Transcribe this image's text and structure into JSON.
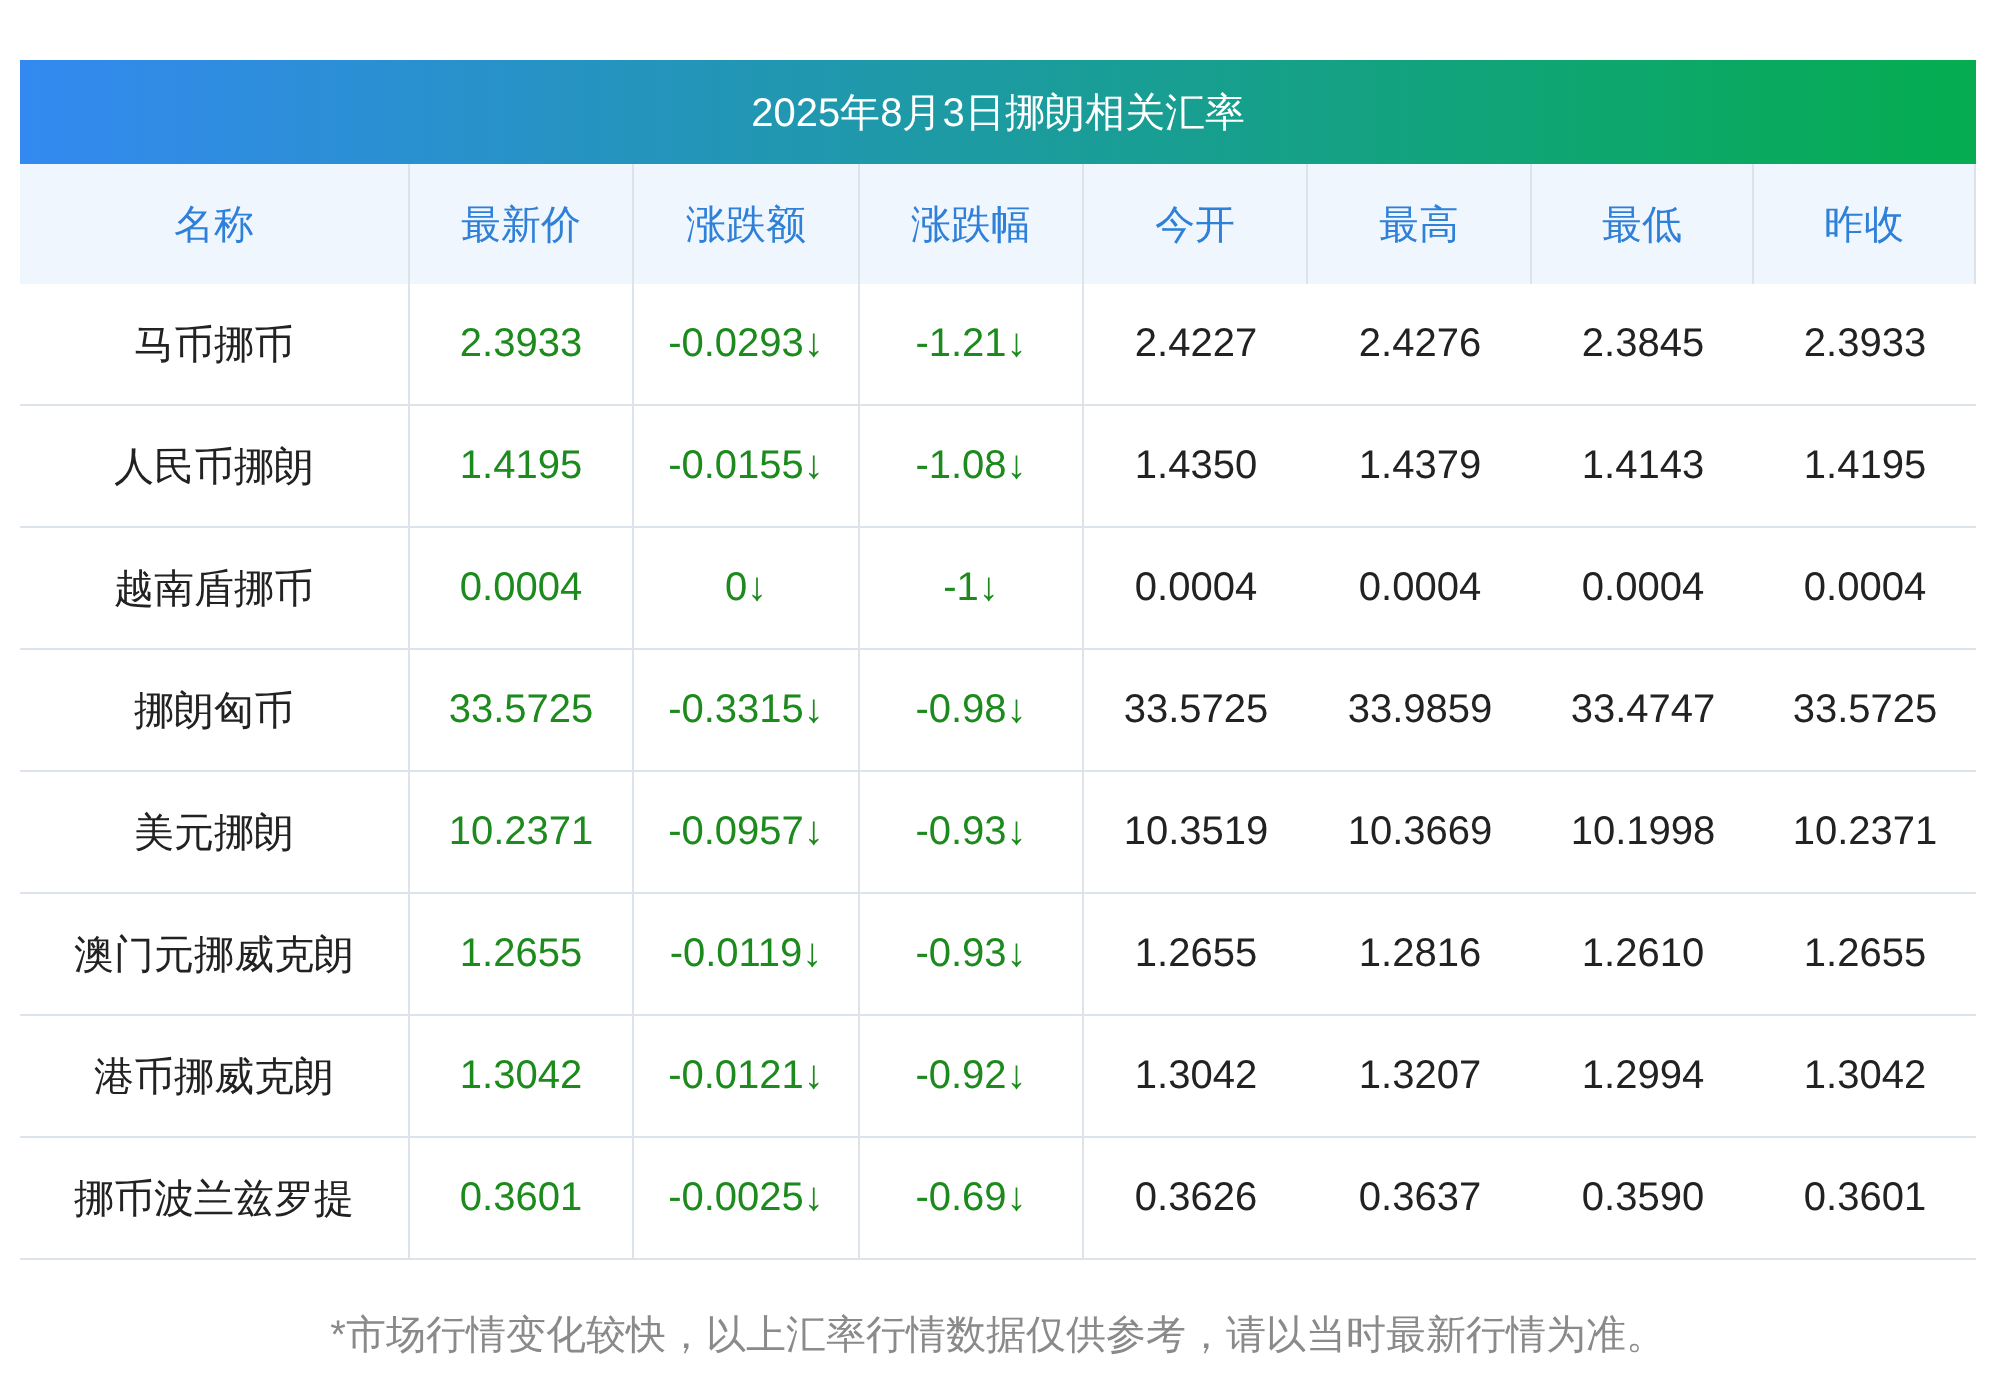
{
  "title": "2025年8月3日挪朗相关汇率",
  "columns": [
    "名称",
    "最新价",
    "涨跌额",
    "涨跌幅",
    "今开",
    "最高",
    "最低",
    "昨收"
  ],
  "rows": [
    {
      "name": "马币挪币",
      "price": "2.3933",
      "change": "-0.0293↓",
      "percent": "-1.21↓",
      "open": "2.4227",
      "high": "2.4276",
      "low": "2.3845",
      "prev_close": "2.3933"
    },
    {
      "name": "人民币挪朗",
      "price": "1.4195",
      "change": "-0.0155↓",
      "percent": "-1.08↓",
      "open": "1.4350",
      "high": "1.4379",
      "low": "1.4143",
      "prev_close": "1.4195"
    },
    {
      "name": "越南盾挪币",
      "price": "0.0004",
      "change": "0↓",
      "percent": "-1↓",
      "open": "0.0004",
      "high": "0.0004",
      "low": "0.0004",
      "prev_close": "0.0004"
    },
    {
      "name": "挪朗匈币",
      "price": "33.5725",
      "change": "-0.3315↓",
      "percent": "-0.98↓",
      "open": "33.5725",
      "high": "33.9859",
      "low": "33.4747",
      "prev_close": "33.5725"
    },
    {
      "name": "美元挪朗",
      "price": "10.2371",
      "change": "-0.0957↓",
      "percent": "-0.93↓",
      "open": "10.3519",
      "high": "10.3669",
      "low": "10.1998",
      "prev_close": "10.2371"
    },
    {
      "name": "澳门元挪威克朗",
      "price": "1.2655",
      "change": "-0.0119↓",
      "percent": "-0.93↓",
      "open": "1.2655",
      "high": "1.2816",
      "low": "1.2610",
      "prev_close": "1.2655"
    },
    {
      "name": "港币挪威克朗",
      "price": "1.3042",
      "change": "-0.0121↓",
      "percent": "-0.92↓",
      "open": "1.3042",
      "high": "1.3207",
      "low": "1.2994",
      "prev_close": "1.3042"
    },
    {
      "name": "挪币波兰兹罗提",
      "price": "0.3601",
      "change": "-0.0025↓",
      "percent": "-0.69↓",
      "open": "0.3626",
      "high": "0.3637",
      "low": "0.3590",
      "prev_close": "0.3601"
    }
  ],
  "footnote": "*市场行情变化较快，以上汇率行情数据仅供参考，请以当时最新行情为准。"
}
